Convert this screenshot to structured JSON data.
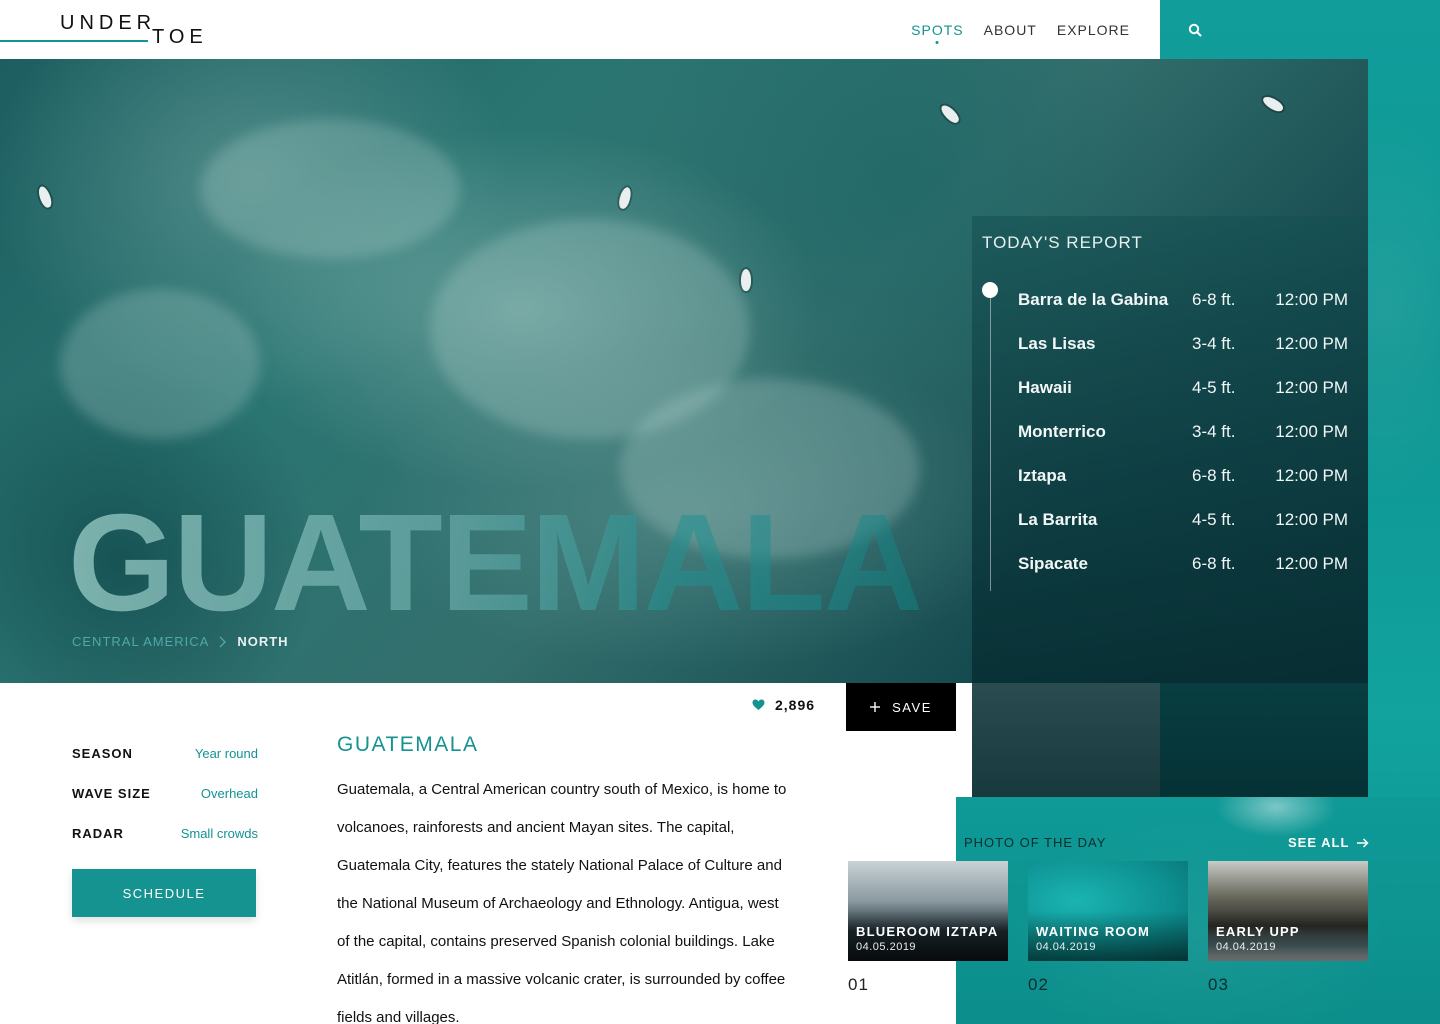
{
  "brand": {
    "logo_top": "UNDER",
    "logo_bottom": "TOE"
  },
  "nav": {
    "items": [
      {
        "label": "SPOTS",
        "active": true
      },
      {
        "label": "ABOUT",
        "active": false
      },
      {
        "label": "EXPLORE",
        "active": false
      }
    ],
    "search_icon": "search-icon"
  },
  "hero": {
    "title": "GUATEMALA",
    "breadcrumb": {
      "region": "CENTRAL AMERICA",
      "separator_icon": "chevron-right-icon",
      "current": "NORTH"
    }
  },
  "report": {
    "title": "TODAY'S REPORT",
    "rows": [
      {
        "spot": "Barra de la Gabina",
        "size": "6-8 ft.",
        "time": "12:00 PM"
      },
      {
        "spot": "Las Lisas",
        "size": "3-4 ft.",
        "time": "12:00 PM"
      },
      {
        "spot": "Hawaii",
        "size": "4-5 ft.",
        "time": "12:00 PM"
      },
      {
        "spot": "Monterrico",
        "size": "3-4 ft.",
        "time": "12:00 PM"
      },
      {
        "spot": "Iztapa",
        "size": "6-8 ft.",
        "time": "12:00 PM"
      },
      {
        "spot": "La Barrita",
        "size": "4-5 ft.",
        "time": "12:00 PM"
      },
      {
        "spot": "Sipacate",
        "size": "6-8 ft.",
        "time": "12:00 PM"
      }
    ]
  },
  "facts": [
    {
      "label": "SEASON",
      "value": "Year round"
    },
    {
      "label": "WAVE SIZE",
      "value": "Overhead"
    },
    {
      "label": "RADAR",
      "value": "Small crowds"
    }
  ],
  "schedule_label": "SCHEDULE",
  "article": {
    "title": "GUATEMALA",
    "body": "Guatemala, a Central American country south of Mexico, is home to volcanoes, rainforests and ancient Mayan sites. The capital, Guatemala City, features the stately National Palace of Culture and the National Museum of Archaeology and Ethnology. Antigua, west of the capital, contains preserved Spanish colonial buildings. Lake Atitlán, formed in a massive volcanic crater, is surrounded by coffee fields and villages."
  },
  "likes": {
    "count": "2,896",
    "icon": "heart-icon"
  },
  "save": {
    "label": "SAVE",
    "icon": "plus-icon"
  },
  "photo_of_the_day": {
    "label": "PHOTO OF THE DAY",
    "see_all": "SEE ALL",
    "see_all_icon": "arrow-right-icon",
    "photos": [
      {
        "name": "BLUEROOM IZTAPA",
        "date": "04.05.2019",
        "number": "01"
      },
      {
        "name": "WAITING ROOM",
        "date": "04.04.2019",
        "number": "02"
      },
      {
        "name": "EARLY UPP",
        "date": "04.04.2019",
        "number": "03"
      }
    ]
  },
  "colors": {
    "accent": "#159391",
    "dark": "#000000",
    "text": "#111111"
  }
}
